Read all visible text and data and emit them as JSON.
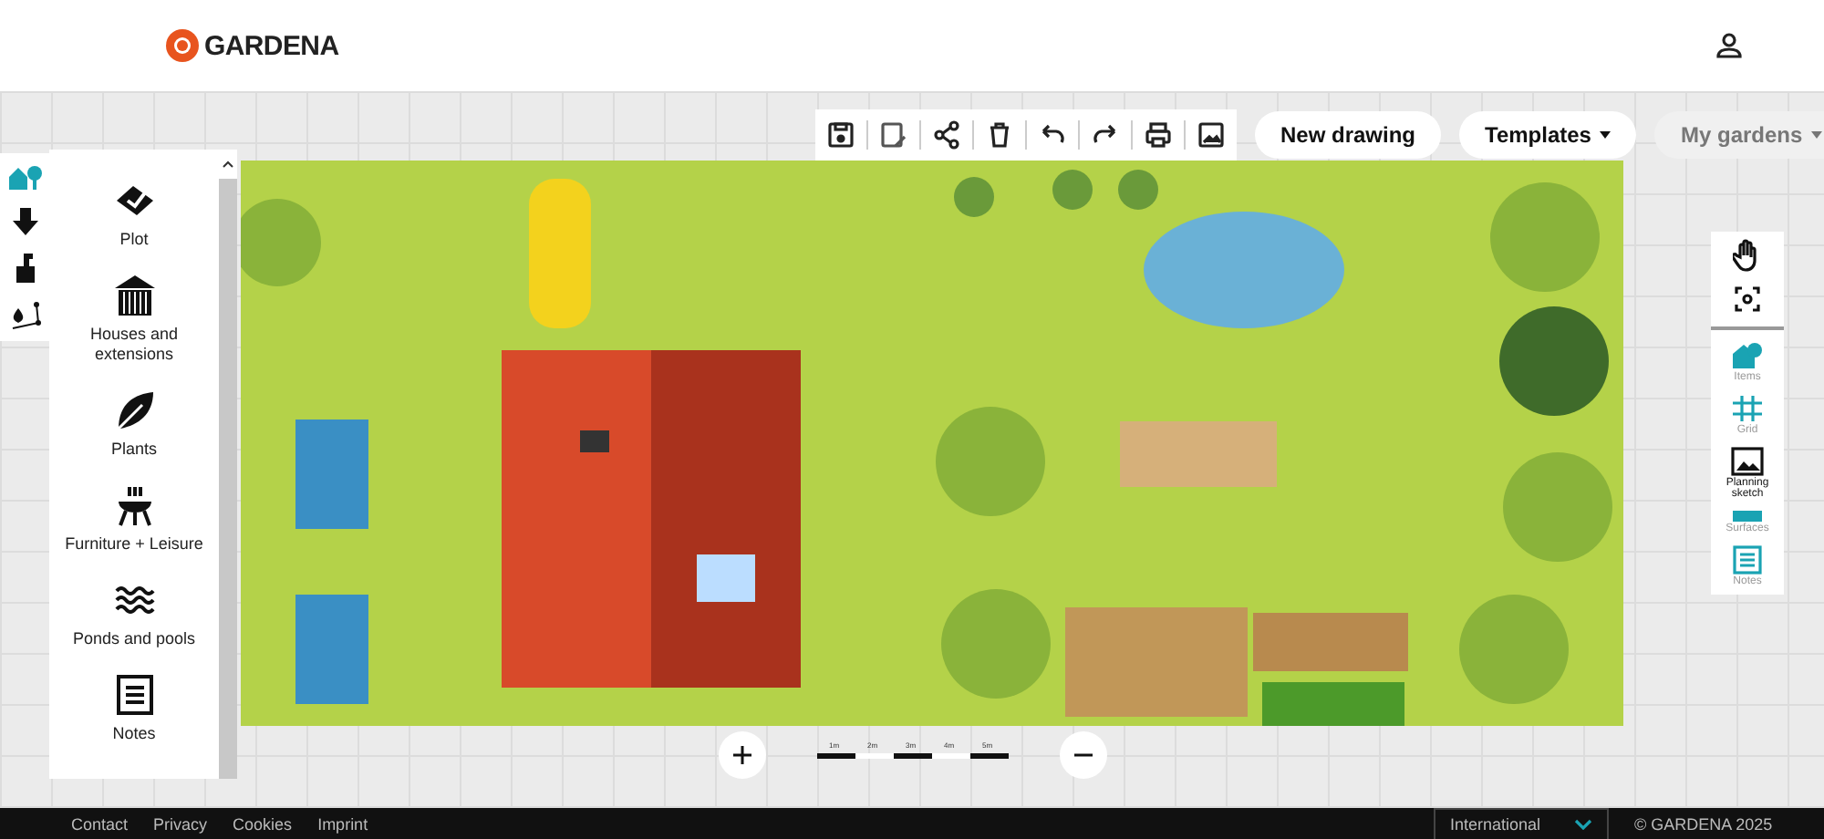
{
  "header": {
    "brand": "GARDENA"
  },
  "toolbar": {
    "buttons": [
      {
        "label": "New drawing",
        "kind": "plain",
        "disabled": false
      },
      {
        "label": "Templates",
        "kind": "dropdown",
        "disabled": false
      },
      {
        "label": "My gardens",
        "kind": "dropdown",
        "disabled": true
      }
    ]
  },
  "side_tabs": [
    {
      "selected": true
    },
    {
      "selected": false
    },
    {
      "selected": false
    },
    {
      "selected": false
    }
  ],
  "categories": [
    "Plot",
    "Houses and extensions",
    "Plants",
    "Furniture + Leisure",
    "Ponds and pools",
    "Notes"
  ],
  "right_tools": [
    {
      "label": "Items",
      "selected": false
    },
    {
      "label": "Grid",
      "selected": false
    },
    {
      "label": "Planning sketch",
      "selected": true
    },
    {
      "label": "Surfaces",
      "selected": false
    },
    {
      "label": "Notes",
      "selected": false
    }
  ],
  "scale": [
    "1m",
    "2m",
    "3m",
    "4m",
    "5m"
  ],
  "footer": {
    "links": [
      "Contact",
      "Privacy",
      "Cookies",
      "Imprint"
    ],
    "region": "International",
    "copyright": "© GARDENA 2025"
  }
}
